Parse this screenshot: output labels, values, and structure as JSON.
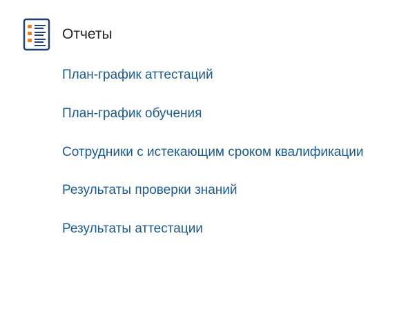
{
  "section": {
    "title": "Отчеты",
    "icon": "report-list-icon",
    "colors": {
      "icon_frame": "#1d3f73",
      "icon_bullets": "#f07d1a",
      "title": "#1f2328",
      "link": "#1a5a94"
    }
  },
  "reports": [
    {
      "label": "План-график аттестаций"
    },
    {
      "label": "План-график обучения"
    },
    {
      "label": "Сотрудники с истекающим сроком квалификации"
    },
    {
      "label": "Результаты проверки знаний"
    },
    {
      "label": "Результаты аттестации"
    }
  ]
}
